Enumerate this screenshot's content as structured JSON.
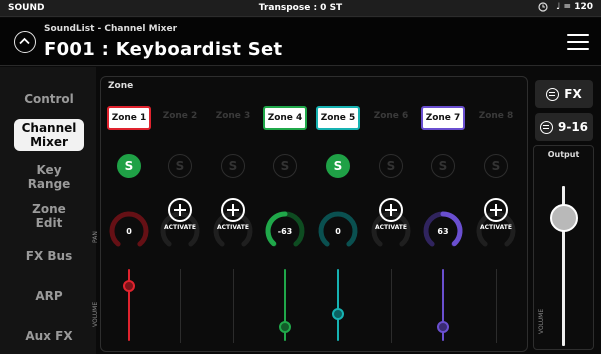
{
  "status_bar": {
    "left": "SOUND",
    "center": "Transpose : 0 ST",
    "tempo": "♩ = 120"
  },
  "header": {
    "subtitle": "SoundList - Channel Mixer",
    "title": "F001 : Keyboardist Set"
  },
  "nav": {
    "control": "Control",
    "channel_mixer": [
      "Channel",
      "Mixer"
    ],
    "key_range": [
      "Key",
      "Range"
    ],
    "zone_edit": [
      "Zone",
      "Edit"
    ],
    "fx_bus": "FX Bus",
    "arp": "ARP",
    "aux_fx": "Aux FX"
  },
  "zone_label": "Zone",
  "zones": [
    {
      "label": "Zone 1",
      "on": true,
      "color": "#e0232e",
      "pan": "0",
      "volume": 0.77
    },
    {
      "label": "Zone 2",
      "on": false,
      "activate": "ACTIVATE"
    },
    {
      "label": "Zone 3",
      "on": false,
      "activate": "ACTIVATE"
    },
    {
      "label": "Zone 4",
      "on": true,
      "color": "#20a84a",
      "pan": "-63",
      "volume": 0.2
    },
    {
      "label": "Zone 5",
      "on": true,
      "color": "#16b2b2",
      "pan": "0",
      "volume": 0.38
    },
    {
      "label": "Zone 6",
      "on": false,
      "activate": "ACTIVATE"
    },
    {
      "label": "Zone 7",
      "on": true,
      "color": "#6a4fd0",
      "pan": "63",
      "volume": 0.2
    },
    {
      "label": "Zone 8",
      "on": false,
      "activate": "ACTIVATE"
    }
  ],
  "solo_label": "S",
  "pan_label": "PAN",
  "volume_label": "VOLUME",
  "fx_button": "FX",
  "channel_button": "9-16",
  "output": {
    "title": "Output",
    "volume_label": "VOLUME",
    "level": 0.9
  },
  "colors": {
    "solo_on": "#1fa146",
    "background": "#0a0a0a"
  }
}
